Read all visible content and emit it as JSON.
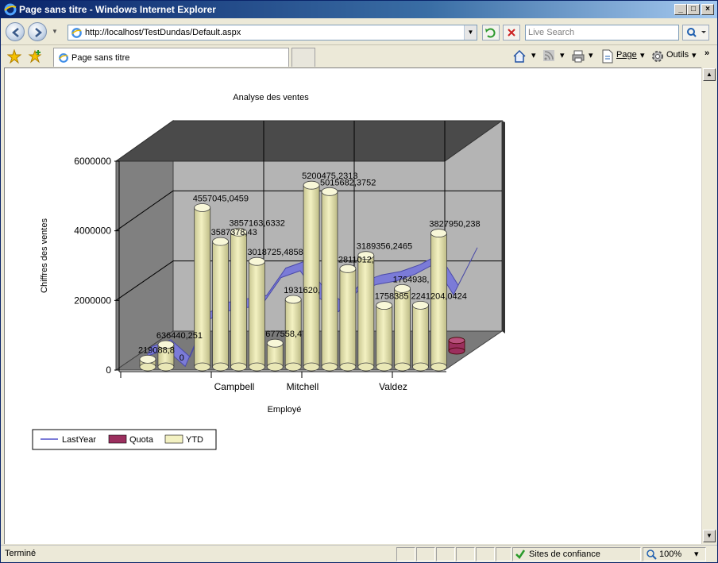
{
  "window": {
    "title": "Page sans titre - Windows Internet Explorer",
    "minimize": "_",
    "maximize": "□",
    "close": "×"
  },
  "address": {
    "url": "http://localhost/TestDundas/Default.aspx"
  },
  "search": {
    "placeholder": "Live Search"
  },
  "tab": {
    "label": "Page sans titre"
  },
  "toolbar": {
    "page_label": "Page",
    "tools_label": "Outils"
  },
  "status": {
    "text": "Terminé",
    "zone": "Sites de confiance",
    "zoom": "100%"
  },
  "chart_data": {
    "type": "bar",
    "title": "Analyse des ventes",
    "xlabel": "Employé",
    "ylabel": "Chiffres des ventes",
    "ylim": [
      0,
      6000000
    ],
    "yticks": [
      "0",
      "2000000",
      "4000000",
      "6000000"
    ],
    "category_labels": [
      "Campbell",
      "Mitchell",
      "Valdez"
    ],
    "legend": [
      "LastYear",
      "Quota",
      "YTD"
    ],
    "legend_position": "bottom-left",
    "colors": {
      "LastYear": "#7b7bd8",
      "Quota": "#9b2f5e",
      "YTD": "#f3f1c2"
    },
    "ytd_values": [
      219088.8,
      636440.251,
      0,
      4557045.0459,
      3587378.43,
      3857163.6332,
      3018725.4858,
      677558.4,
      1931620,
      5200475.2313,
      5015682.3752,
      2811012,
      3189356.2465,
      1758385,
      2241204.0424,
      1764938,
      3827950.238
    ],
    "ytd_labels": [
      "219088,8",
      "636440,251",
      "0",
      "4557045,0459",
      "3587378,43",
      "3857163,6332",
      "3018725,4858",
      "677558,4",
      "1931620,",
      "5200475,2313",
      "5015682,3752",
      "2811012,",
      "3189356,2465",
      "1758385",
      "1764938,",
      "2241204,0424",
      "3827950,238"
    ],
    "lastyear_values": [
      500000,
      700000,
      200000,
      1500000,
      1800000,
      1900000,
      2000000,
      2800000,
      3000000,
      2200000,
      1800000,
      2400000,
      2600000,
      2700000,
      2900000,
      3200000,
      2300000,
      3400000
    ],
    "quota_values": [
      300000
    ]
  }
}
